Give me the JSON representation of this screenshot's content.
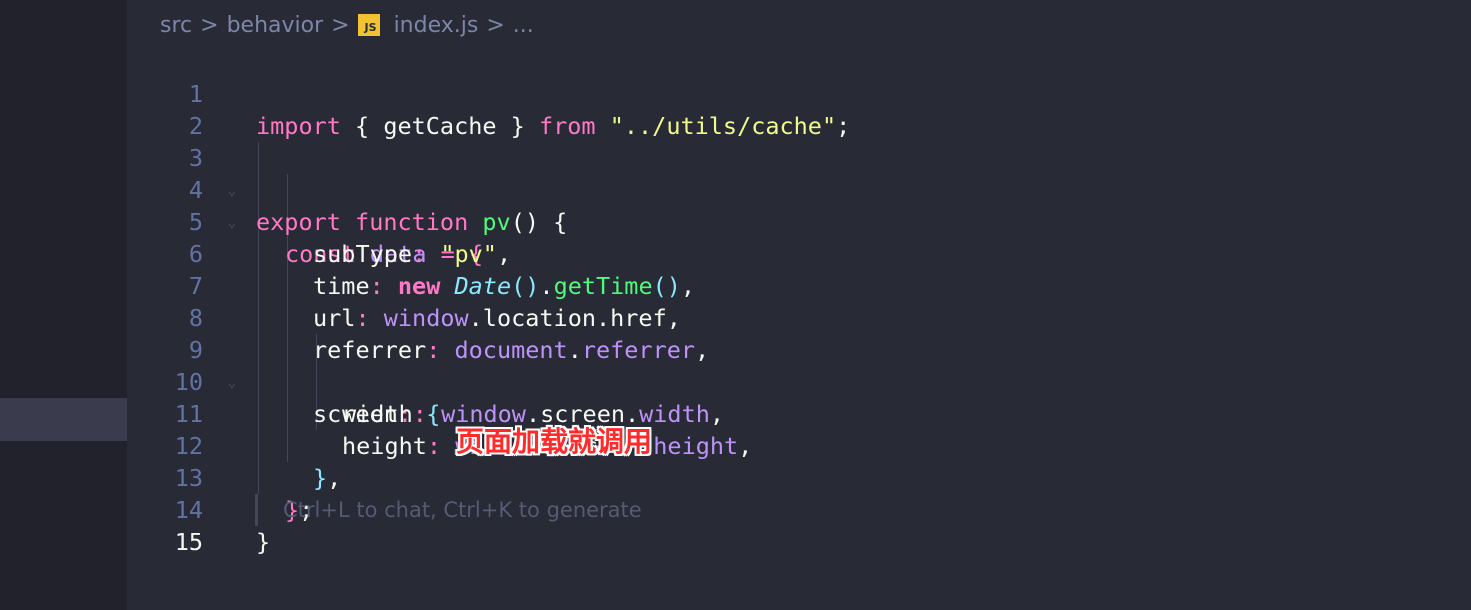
{
  "breadcrumb": {
    "items": [
      "src",
      "behavior",
      "index.js",
      "..."
    ],
    "file_badge": "JS",
    "separator": ">"
  },
  "editor": {
    "current_line": 15,
    "placeholder": "Ctrl+L to chat, Ctrl+K to generate",
    "lines": [
      {
        "n": "1"
      },
      {
        "n": "2"
      },
      {
        "n": "3"
      },
      {
        "n": "4"
      },
      {
        "n": "5"
      },
      {
        "n": "6"
      },
      {
        "n": "7"
      },
      {
        "n": "8"
      },
      {
        "n": "9"
      },
      {
        "n": "10"
      },
      {
        "n": "11"
      },
      {
        "n": "12"
      },
      {
        "n": "13"
      },
      {
        "n": "14"
      },
      {
        "n": "15"
      }
    ],
    "tokens": {
      "l1": [
        "import",
        " { ",
        "getCache",
        " } ",
        "from",
        " ",
        "\"../utils/cache\"",
        ";"
      ],
      "l3": [
        "export",
        " ",
        "function",
        " ",
        "pv",
        "() {"
      ],
      "l4": [
        "const",
        " ",
        "data",
        " ",
        "=",
        " ",
        "{"
      ],
      "l5": [
        "subType",
        ":",
        " ",
        "\"pv\"",
        ","
      ],
      "l6": [
        "time",
        ":",
        " ",
        "new",
        " ",
        "Date",
        "()",
        ".",
        "getTime",
        "()",
        ","
      ],
      "l7": [
        "url",
        ":",
        " ",
        "window",
        ".location.href,"
      ],
      "l8": [
        "referrer",
        ":",
        " ",
        "document",
        ".",
        "referrer",
        ","
      ],
      "l9": [
        "screen",
        ":",
        " ",
        "{"
      ],
      "l10": [
        "width",
        ":",
        " ",
        "window",
        ".screen.",
        "width",
        ","
      ],
      "l11": [
        "height",
        ":",
        " ",
        "window",
        ".screen.",
        "height",
        ","
      ],
      "l12": [
        "}",
        ","
      ],
      "l13": [
        "}",
        ";"
      ],
      "l14": [
        "}"
      ]
    }
  },
  "annotation": {
    "text": "页面加载就调用",
    "color": "#ff2a2a"
  },
  "colors": {
    "background": "#282a36",
    "keyword": "#ff79c6",
    "string": "#f1fa8c",
    "function": "#50fa7b",
    "variable": "#bd93f9",
    "class": "#8be9fd"
  }
}
